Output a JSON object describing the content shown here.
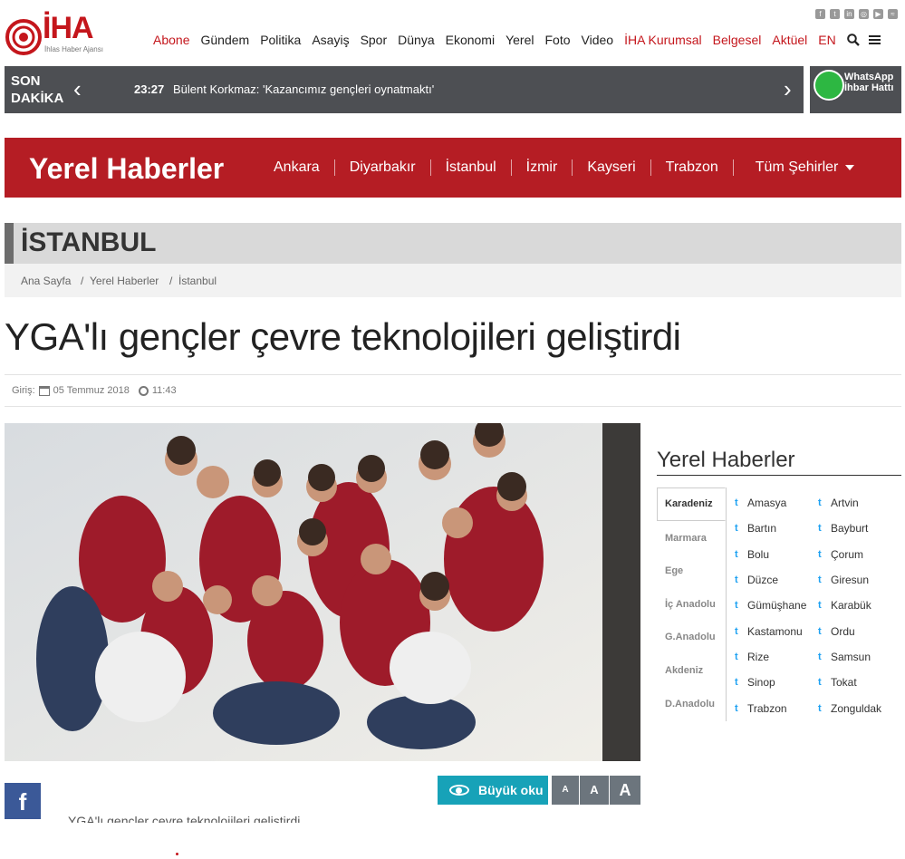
{
  "header": {
    "logo_text": "İHA",
    "logo_sub": "İhlas Haber Ajansı",
    "nav": [
      {
        "label": "Abone",
        "red": true
      },
      {
        "label": "Gündem",
        "red": false
      },
      {
        "label": "Politika",
        "red": false
      },
      {
        "label": "Asayiş",
        "red": false
      },
      {
        "label": "Spor",
        "red": false
      },
      {
        "label": "Dünya",
        "red": false
      },
      {
        "label": "Ekonomi",
        "red": false
      },
      {
        "label": "Yerel",
        "red": false
      },
      {
        "label": "Foto",
        "red": false
      },
      {
        "label": "Video",
        "red": false
      },
      {
        "label": "İHA Kurumsal",
        "red": true
      },
      {
        "label": "Belgesel",
        "red": true
      },
      {
        "label": "Aktüel",
        "red": true
      },
      {
        "label": "EN",
        "red": true
      }
    ],
    "social_icons": [
      "facebook-icon",
      "twitter-icon",
      "linkedin-icon",
      "instagram-icon",
      "youtube-icon",
      "rss-icon"
    ]
  },
  "breaking": {
    "label_1": "SON",
    "label_2": "DAKİKA",
    "time": "23:27",
    "headline": "Bülent Korkmaz: 'Kazancımız gençleri oynatmaktı'"
  },
  "whatsapp": {
    "line1": "WhatsApp",
    "line2": "İhbar Hattı"
  },
  "yerel": {
    "title": "Yerel Haberler",
    "cities": [
      "Ankara",
      "Diyarbakır",
      "İstanbul",
      "İzmir",
      "Kayseri",
      "Trabzon"
    ],
    "all_cities": "Tüm Şehirler"
  },
  "section": {
    "title": "İSTANBUL",
    "breadcrumb": [
      "Ana Sayfa",
      "Yerel Haberler",
      "İstanbul"
    ]
  },
  "article": {
    "headline": "YGA'lı gençler çevre teknolojileri geliştirdi",
    "entry_label": "Giriş:",
    "date": "05 Temmuz 2018",
    "time": "11:43",
    "cut_text": "YGA'lı gençler çevre teknolojileri geliştirdi..."
  },
  "sidebar": {
    "title": "Yerel Haberler",
    "regions": [
      "Karadeniz",
      "Marmara",
      "Ege",
      "İç Anadolu",
      "G.Anadolu",
      "Akdeniz",
      "D.Anadolu"
    ],
    "active_region": "Karadeniz",
    "cities_left": [
      "Amasya",
      "Bartın",
      "Bolu",
      "Düzce",
      "Gümüşhane",
      "Kastamonu",
      "Rize",
      "Sinop",
      "Trabzon"
    ],
    "cities_right": [
      "Artvin",
      "Bayburt",
      "Çorum",
      "Giresun",
      "Karabük",
      "Ordu",
      "Samsun",
      "Tokat",
      "Zonguldak"
    ]
  },
  "tools": {
    "read_big": "Büyük oku",
    "font_small": "A",
    "font_medium": "A",
    "font_large": "A"
  },
  "colors": {
    "brand_red": "#c4161c",
    "band_red": "#b51d24",
    "dark_gray": "#4d4f53",
    "teal": "#17a2b8",
    "facebook": "#3b5998"
  }
}
